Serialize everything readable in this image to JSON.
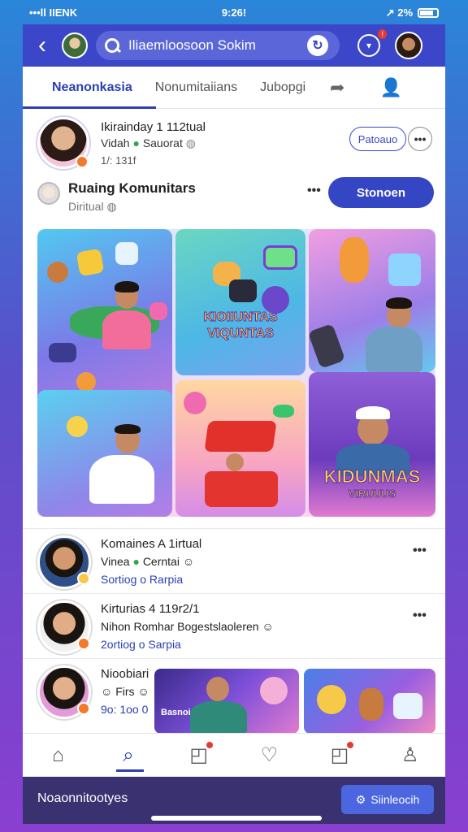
{
  "status_bar": {
    "carrier": "•••ll IIENK",
    "time": "9:26!",
    "battery": "↗ 2%"
  },
  "app_bar": {
    "search_value": "Iliaemloosoon Sokim",
    "notif_badge": "!"
  },
  "tabs": [
    {
      "label": "Neanonkasia",
      "active": true
    },
    {
      "label": "Nonumitaiians",
      "active": false
    },
    {
      "label": "Jubopgi",
      "active": false
    }
  ],
  "post": {
    "author": "Ikirainday 1 112tual",
    "meta": "Vidah",
    "meta2": "Sauorat",
    "time": "1/: 131f",
    "follow_label": "Patoauo",
    "group_name": "Ruaing Komunitars",
    "group_sub": "Diritual",
    "join_label": "Stonoen"
  },
  "collage": {
    "title1": "KIOIIUNTAS",
    "title1b": "VIQUNTAS",
    "title2": "KIDUNMAS",
    "title2b": "VIRUUUS"
  },
  "list": [
    {
      "name": "Komaines A 1irtual",
      "sub_a": "Vinea",
      "sub_b": "Cerntai",
      "link": "Sortiog o Rarpia"
    },
    {
      "name": "Kirturias 4 119r2/1",
      "sub": "Nihon Romhar Bogestslaoleren",
      "link": "2ortiog o Sarpia"
    },
    {
      "name": "Nioobiari",
      "sub": "Firs",
      "link": "9o: 1oo 0",
      "thumb_label": "Basnoi"
    }
  ],
  "footer": {
    "text": "Noaonnitootyes",
    "button": "Siinleocih"
  },
  "colors": {
    "primary": "#3b47c8",
    "accent": "#2c3fb5",
    "badge": "#e53935"
  }
}
